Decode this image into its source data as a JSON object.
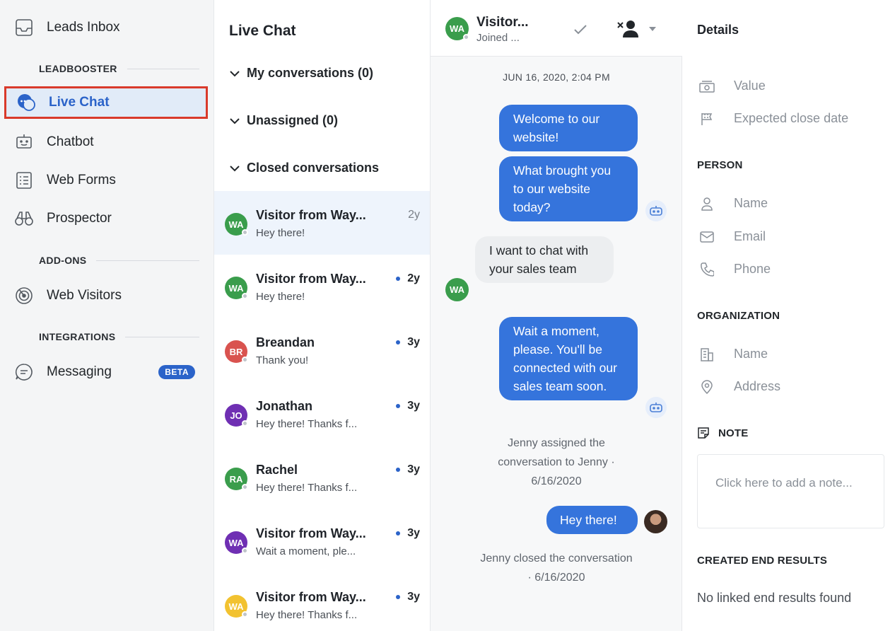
{
  "sidebar": {
    "leads_inbox": "Leads Inbox",
    "section_leadbooster": "LEADBOOSTER",
    "live_chat": "Live Chat",
    "chatbot": "Chatbot",
    "web_forms": "Web Forms",
    "prospector": "Prospector",
    "section_addons": "ADD-ONS",
    "web_visitors": "Web Visitors",
    "section_integrations": "INTEGRATIONS",
    "messaging": "Messaging",
    "messaging_badge": "BETA"
  },
  "convlist": {
    "title": "Live Chat",
    "groups": [
      "My conversations (0)",
      "Unassigned (0)",
      "Closed conversations"
    ],
    "items": [
      {
        "initials": "WA",
        "name": "Visitor from Way...",
        "preview": "Hey there!",
        "time": "2y",
        "color": "#3a9d4c"
      },
      {
        "initials": "WA",
        "name": "Visitor from Way...",
        "preview": "Hey there!",
        "time": "2y",
        "color": "#3a9d4c"
      },
      {
        "initials": "BR",
        "name": "Breandan",
        "preview": "Thank you!",
        "time": "3y",
        "color": "#d9534f"
      },
      {
        "initials": "JO",
        "name": "Jonathan",
        "preview": "Hey there! Thanks f...",
        "time": "3y",
        "color": "#6f2fb3"
      },
      {
        "initials": "RA",
        "name": "Rachel",
        "preview": "Hey there! Thanks f...",
        "time": "3y",
        "color": "#3a9d4c"
      },
      {
        "initials": "WA",
        "name": "Visitor from Way...",
        "preview": "Wait a moment, ple...",
        "time": "3y",
        "color": "#6f2fb3"
      },
      {
        "initials": "WA",
        "name": "Visitor from Way...",
        "preview": "Hey there! Thanks f...",
        "time": "3y",
        "color": "#f2c230"
      }
    ]
  },
  "chat": {
    "header": {
      "initials": "WA",
      "name": "Visitor...",
      "status": "Joined ..."
    },
    "date": "JUN 16, 2020, 2:04 PM",
    "msg1": "Welcome to our website!",
    "msg2": "What brought you to our website today?",
    "msg3": "I want to chat with your sales team",
    "msg3_avatar": "WA",
    "msg4": "Wait a moment, please. You'll be connected with our sales team soon.",
    "sys1": "Jenny assigned the conversation to Jenny · 6/16/2020",
    "msg5": "Hey there!",
    "sys2": "Jenny closed the conversation · 6/16/2020"
  },
  "details": {
    "title": "Details",
    "value": "Value",
    "expected_close": "Expected close date",
    "person": "PERSON",
    "person_name": "Name",
    "person_email": "Email",
    "person_phone": "Phone",
    "organization": "ORGANIZATION",
    "org_name": "Name",
    "org_address": "Address",
    "note": "NOTE",
    "note_placeholder": "Click here to add a note...",
    "created_end_results": "CREATED END RESULTS",
    "no_results": "No linked end results found"
  }
}
